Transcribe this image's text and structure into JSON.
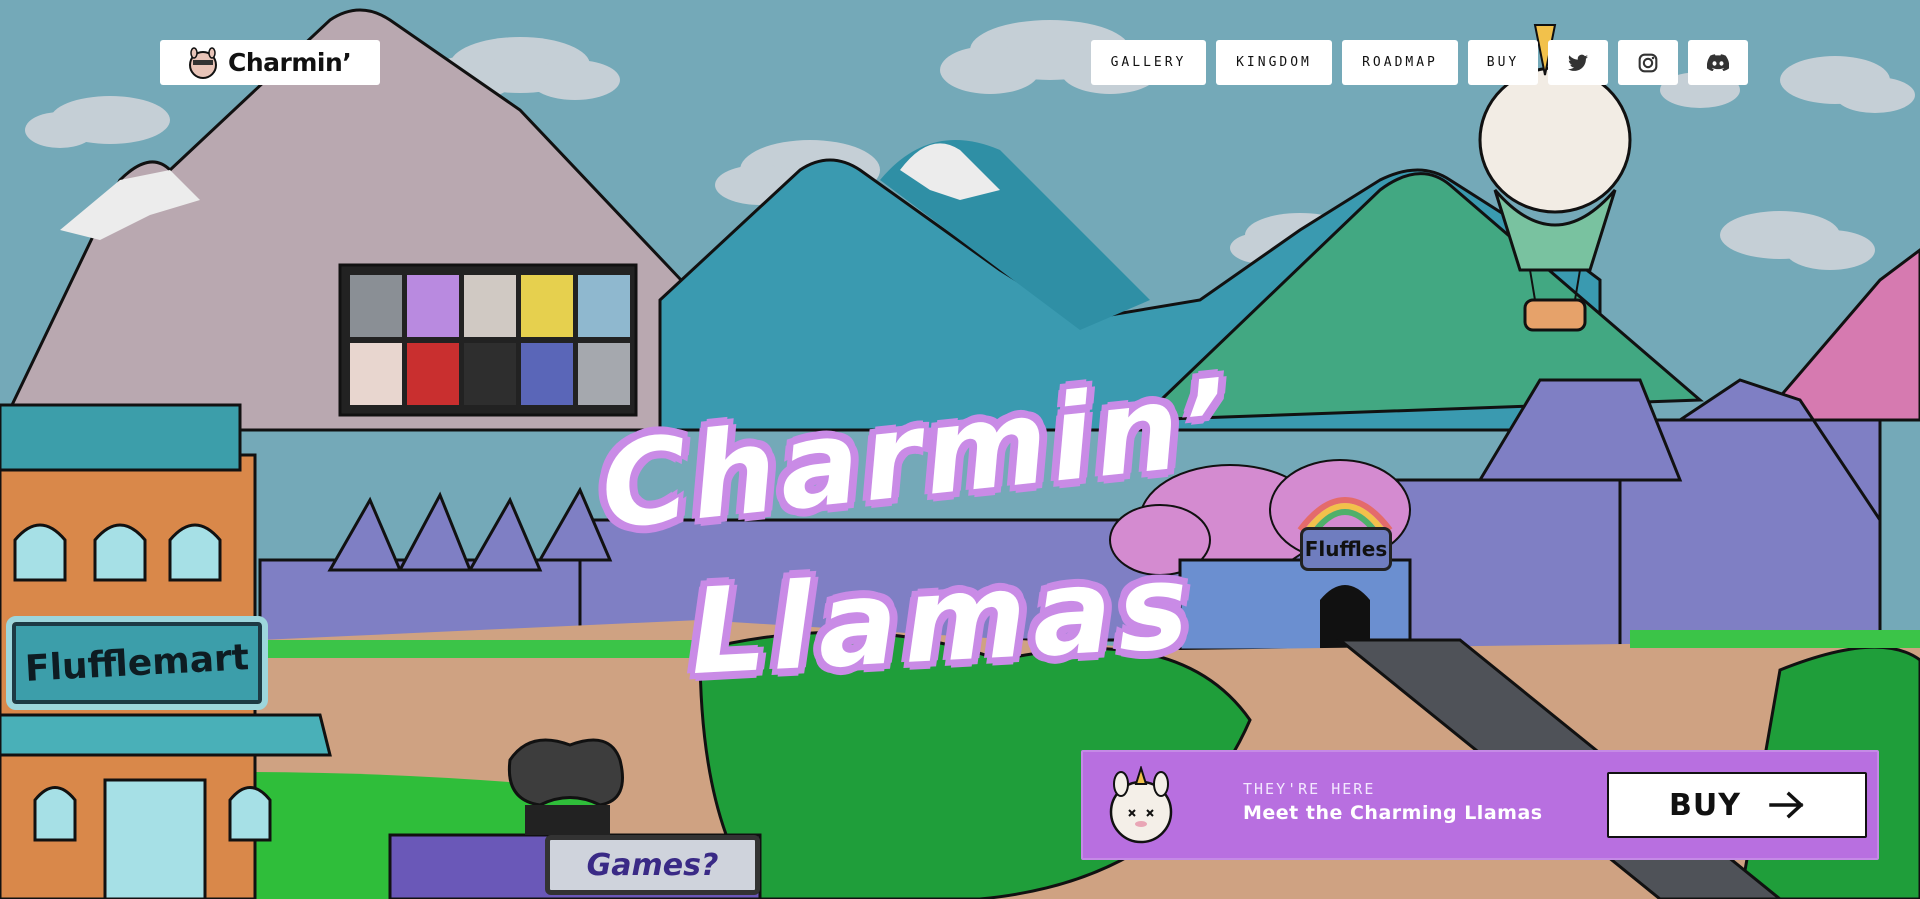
{
  "brand": {
    "name": "Charmin’"
  },
  "nav": {
    "items": [
      "GALLERY",
      "KINGDOM",
      "ROADMAP",
      "BUY"
    ],
    "social": [
      "twitter-icon",
      "instagram-icon",
      "discord-icon"
    ]
  },
  "hero": {
    "title_line1": "Charmin’",
    "title_line2": "Llamas"
  },
  "scene_signs": {
    "store": "Flufflemart",
    "shop": "Fluffles",
    "games": "Games?"
  },
  "cta": {
    "eyebrow": "THEY'RE HERE",
    "title": "Meet the Charming Llamas",
    "button": "BUY"
  },
  "colors": {
    "sky": "#74a9b8",
    "accent_purple": "#b86fe0",
    "title_outline": "#c98be6"
  }
}
